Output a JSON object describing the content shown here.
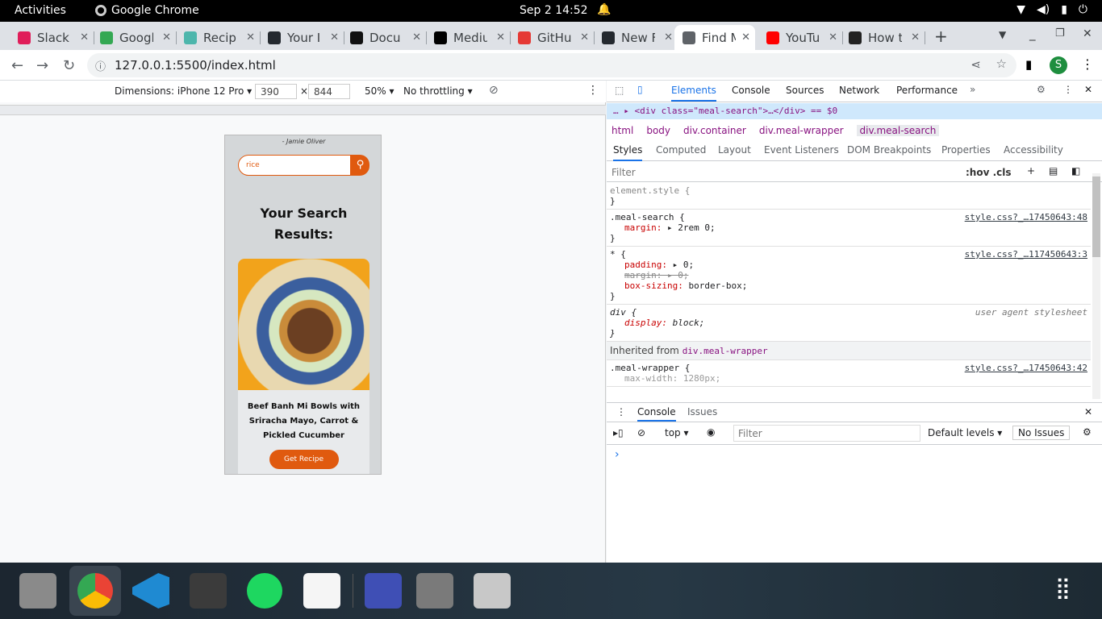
{
  "system": {
    "activities": "Activities",
    "app": "Google Chrome",
    "clock": "Sep 2  14:52"
  },
  "tabs": [
    {
      "title": "Slack",
      "color": "#e01e5a"
    },
    {
      "title": "Googl",
      "color": "#34a853"
    },
    {
      "title": "Recip",
      "color": "#4db6ac"
    },
    {
      "title": "Your I",
      "color": "#24292f"
    },
    {
      "title": "Docu",
      "color": "#111111"
    },
    {
      "title": "Mediu",
      "color": "#000000"
    },
    {
      "title": "GitHu",
      "color": "#e53935"
    },
    {
      "title": "New F",
      "color": "#24292f"
    },
    {
      "title": "Find M",
      "color": "#5f6368"
    },
    {
      "title": "YouTu",
      "color": "#ff0000"
    },
    {
      "title": "How t",
      "color": "#222222"
    }
  ],
  "address": {
    "url": "127.0.0.1:5500/index.html",
    "profile": "S"
  },
  "device_toolbar": {
    "dimensions": "Dimensions: iPhone 12 Pro",
    "width": "390",
    "height": "844",
    "zoom": "50%",
    "throttle": "No throttling"
  },
  "page": {
    "quote": "- Jamie Oliver",
    "search_value": "rice",
    "results_title": "Your Search Results:",
    "meal_name": "Beef Banh Mi Bowls with Sriracha Mayo, Carrot & Pickled Cucumber",
    "get_recipe": "Get Recipe"
  },
  "devtools": {
    "tabs": [
      "Elements",
      "Console",
      "Sources",
      "Network",
      "Performance"
    ],
    "selected_node": "<div class=\"meal-search\">…</div> == $0",
    "crumbs": [
      "html",
      "body",
      "div.container",
      "div.meal-wrapper",
      "div.meal-search"
    ],
    "subtabs": [
      "Styles",
      "Computed",
      "Layout",
      "Event Listeners",
      "DOM Breakpoints",
      "Properties",
      "Accessibility"
    ],
    "filter_placeholder": "Filter",
    "hov": ":hov  .cls",
    "rules": {
      "element_style": "element.style {",
      "r1_selector": ".meal-search {",
      "r1_src": "style.css?_…17450643:48",
      "r1_prop": "margin",
      "r1_val": "▸ 2rem 0;",
      "r2_selector": "* {",
      "r2_src": "style.css?_…117450643:3",
      "r2_p1": "padding",
      "r2_v1": "▸ 0;",
      "r2_p2": "margin",
      "r2_v2": "▸ 0;",
      "r2_p3": "box-sizing",
      "r2_v3": "border-box;",
      "r3_selector": "div {",
      "r3_src": "user agent stylesheet",
      "r3_prop": "display",
      "r3_val": "block;",
      "inherited": "Inherited from",
      "inherited_from": "div.meal-wrapper",
      "r4_selector": ".meal-wrapper {",
      "r4_src": "style.css?_…17450643:42",
      "r4_prop": "max-width",
      "r4_val": "1280px;"
    },
    "console": {
      "tab1": "Console",
      "tab2": "Issues",
      "context": "top",
      "filter": "Filter",
      "levels": "Default levels",
      "issues": "No Issues",
      "prompt": "›"
    }
  }
}
